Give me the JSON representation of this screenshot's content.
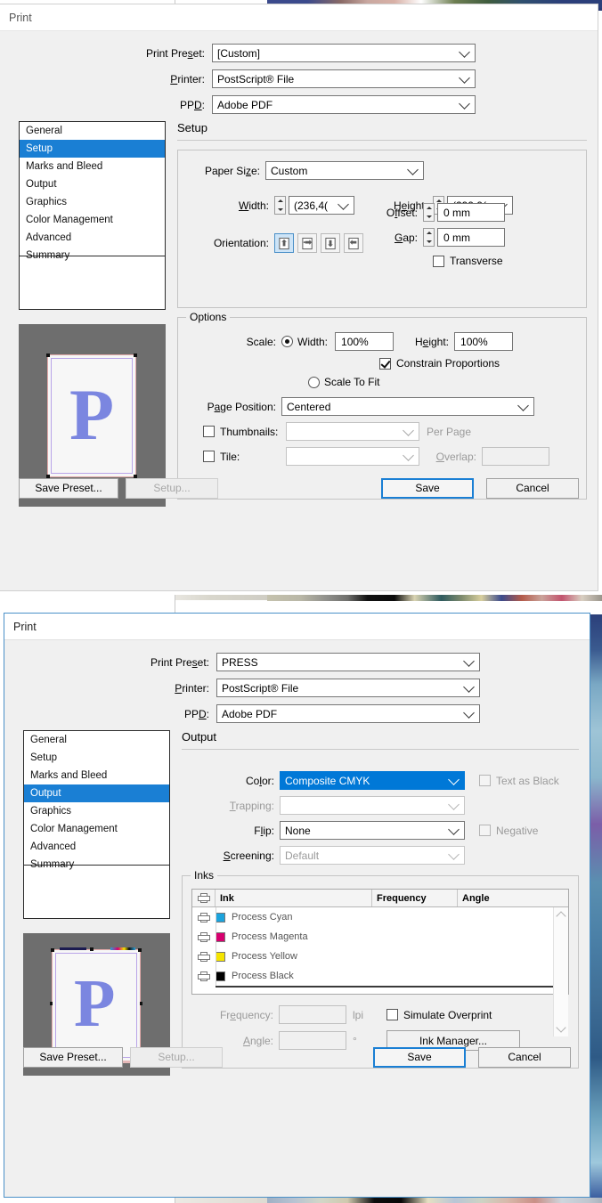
{
  "background": {
    "description": "color-strips-of-underlying-application"
  },
  "dialogs": [
    {
      "id": "print-setup",
      "title": "Print",
      "header": {
        "preset_label": "Print Pre<u>s</u>et:",
        "preset_value": "[Custom]",
        "printer_label": "<u>P</u>rinter:",
        "printer_value": "PostScript® File",
        "ppd_label": "PP<u>D</u>:",
        "ppd_value": "Adobe PDF"
      },
      "nav": {
        "items": [
          "General",
          "Setup",
          "Marks and Bleed",
          "Output",
          "Graphics",
          "Color Management",
          "Advanced",
          "Summary"
        ],
        "selected": "Setup"
      },
      "panel_title": "Setup",
      "setup": {
        "paper_size_label": "Paper Si<u>z</u>e:",
        "paper_size_value": "Custom",
        "width_label": "<u>W</u>idth:",
        "width_value": "(236,4(",
        "height_label": "H<u>e</u>ight:",
        "height_value": "(299,9(",
        "offset_label": "O<u>f</u>fset:",
        "offset_value": "0 mm",
        "gap_label": "<u>G</u>ap:",
        "gap_value": "0 mm",
        "orientation_label": "Orientation:",
        "orientation_options": [
          "portrait",
          "landscape",
          "portrait-flipped",
          "landscape-flipped"
        ],
        "orientation_selected": 0,
        "transverse_label": "Transverse",
        "transverse_checked": false
      },
      "options": {
        "legend": "Options",
        "scale_label": "Scale:",
        "scale_width_label": "Width:",
        "scale_width_value": "100%",
        "scale_height_label": "H<u>e</u>ight:",
        "scale_height_value": "100%",
        "constrain_label": "Constrain Proportions",
        "constrain_checked": true,
        "scale_to_fit_label": "Scale To Fit",
        "scale_mode": "width",
        "page_position_label": "P<u>a</u>ge Position:",
        "page_position_value": "Centered",
        "thumbnails_label": "Thumbnails:",
        "thumbnails_checked": false,
        "thumbnails_value": "",
        "per_page_label": "Per Page",
        "tile_label": "Tile:",
        "tile_checked": false,
        "tile_value": "",
        "overlap_label": "<u>O</u>verlap:",
        "overlap_value": ""
      },
      "preview": {
        "letter": "P"
      },
      "footer": {
        "save_preset": "Save Preset...",
        "setup": "Setup...",
        "save": "Save",
        "cancel": "Cancel"
      }
    },
    {
      "id": "print-output",
      "title": "Print",
      "header": {
        "preset_label": "Print Pre<u>s</u>et:",
        "preset_value": "PRESS",
        "printer_label": "<u>P</u>rinter:",
        "printer_value": "PostScript® File",
        "ppd_label": "PP<u>D</u>:",
        "ppd_value": "Adobe PDF"
      },
      "nav": {
        "items": [
          "General",
          "Setup",
          "Marks and Bleed",
          "Output",
          "Graphics",
          "Color Management",
          "Advanced",
          "Summary"
        ],
        "selected": "Output"
      },
      "panel_title": "Output",
      "output": {
        "color_label": "Co<u>l</u>or:",
        "color_value": "Composite CMYK",
        "color_highlighted": true,
        "text_as_black_label": "Text as Black",
        "text_as_black_checked": false,
        "text_as_black_disabled": true,
        "trapping_label": "<u>T</u>rapping:",
        "trapping_value": "",
        "trapping_disabled": true,
        "flip_label": "F<u>l</u>ip:",
        "flip_value": "None",
        "negative_label": "Negative",
        "negative_checked": false,
        "negative_disabled": true,
        "screening_label": "<u>S</u>creening:",
        "screening_value": "Default",
        "screening_disabled": true
      },
      "inks": {
        "legend": "Inks",
        "columns": [
          "",
          "Ink",
          "Frequency",
          "Angle"
        ],
        "rows": [
          {
            "name": "Process Cyan",
            "color": "#1CA3DC",
            "frequency": "",
            "angle": ""
          },
          {
            "name": "Process Magenta",
            "color": "#D6006E",
            "frequency": "",
            "angle": ""
          },
          {
            "name": "Process Yellow",
            "color": "#F5E400",
            "frequency": "",
            "angle": ""
          },
          {
            "name": "Process Black",
            "color": "#000000",
            "frequency": "",
            "angle": ""
          }
        ],
        "frequency_label": "Fr<u>e</u>quency:",
        "frequency_value": "",
        "frequency_unit": "lpi",
        "angle_label": "<u>A</u>ngle:",
        "angle_value": "",
        "angle_unit": "°",
        "simulate_overprint_label": "Simulate Overprint",
        "simulate_overprint_checked": false,
        "ink_manager_label": "Ink Manager..."
      },
      "preview": {
        "letter": "P"
      },
      "footer": {
        "save_preset": "Save Preset...",
        "setup": "Setup...",
        "save": "Save",
        "cancel": "Cancel"
      }
    }
  ],
  "colors": {
    "selection_blue": "#1A7FD4",
    "combo_highlight": "#0078D7",
    "dialog_bg": "#F0F0F0",
    "preview_bg": "#6E6E6E",
    "letter_color": "#7B86E0"
  }
}
